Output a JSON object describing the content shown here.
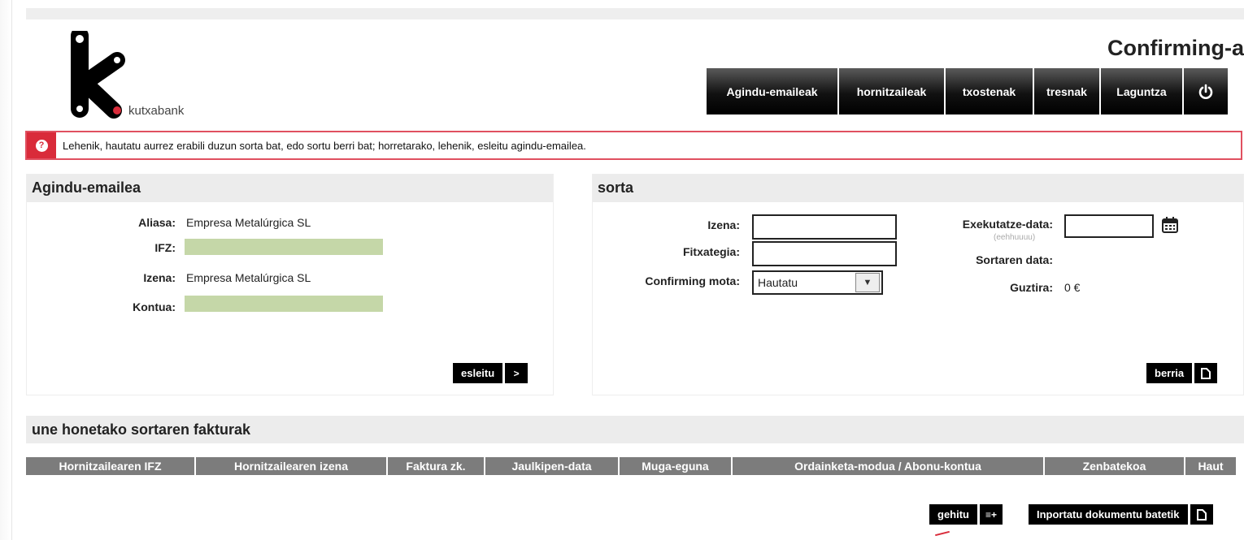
{
  "brand": {
    "name": "kutxabank"
  },
  "app_title": "Confirming-a",
  "nav": {
    "items": [
      "Agindu-emaileak",
      "hornitzaileak",
      "txostenak",
      "tresnak",
      "Laguntza"
    ],
    "power_icon": "power-icon"
  },
  "alert": {
    "text": "Lehenik, hautatu aurrez erabili duzun sorta bat, edo sortu berri bat; horretarako, lehenik, esleitu agindu-emailea.",
    "icon": "question-icon",
    "color": "#d92b3a"
  },
  "ordering_party": {
    "title": "Agindu-emailea",
    "alias_label": "Aliasa:",
    "alias_value": "Empresa Metalúrgica SL",
    "ifz_label": "IFZ:",
    "name_label": "Izena:",
    "name_value": "Empresa Metalúrgica SL",
    "account_label": "Kontua:",
    "assign_button": "esleitu",
    "assign_icon": "chevron-right-icon"
  },
  "batch": {
    "title": "sorta",
    "name_label": "Izena:",
    "name_value": "",
    "file_label": "Fitxategia:",
    "file_value": "",
    "type_label": "Confirming mota:",
    "type_value": "Hautatu",
    "exec_date_label": "Exekutatze-data:",
    "exec_date_hint": "(eehhuuuu)",
    "exec_date_value": "",
    "batch_date_label": "Sortaren data:",
    "total_label": "Guztira:",
    "total_value": "0 €",
    "new_button": "berria",
    "new_icon": "document-icon"
  },
  "invoices": {
    "title": "une honetako sortaren fakturak",
    "columns": [
      "Hornitzailearen IFZ",
      "Hornitzailearen izena",
      "Faktura zk.",
      "Jaulkipen-data",
      "Muga-eguna",
      "Ordainketa-modua / Abonu-kontua",
      "Zenbatekoa",
      "Haut"
    ],
    "add_button": "gehitu",
    "add_icon_text": "≡+",
    "import_button": "Inportatu dokumentu batetik",
    "import_icon": "document-icon"
  },
  "colors": {
    "alert_red": "#d92b3a",
    "header_gray": "#ececec",
    "table_header": "#7c7c7c",
    "redacted": "#c5d7a8"
  }
}
